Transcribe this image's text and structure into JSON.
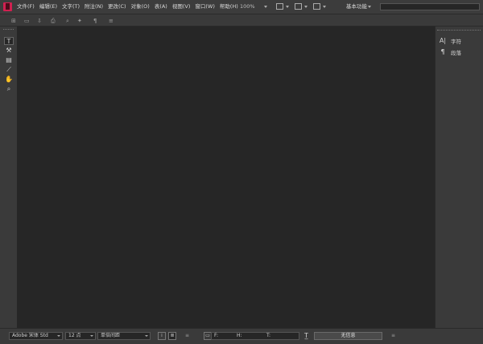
{
  "menu": [
    "文件(F)",
    "编辑(E)",
    "文字(T)",
    "附注(N)",
    "更改(C)",
    "对象(O)",
    "表(A)",
    "视图(V)",
    "窗口(W)",
    "帮助(H)"
  ],
  "zoom": "100%",
  "workspace": "基本功能",
  "tools": [
    {
      "icon": "type-tool-icon",
      "glyph": "T"
    },
    {
      "icon": "type-on-path-icon",
      "glyph": "⚒"
    },
    {
      "icon": "note-tool-icon",
      "glyph": "▤"
    },
    {
      "icon": "eyedropper-icon",
      "glyph": "⟋"
    },
    {
      "icon": "hand-tool-icon",
      "glyph": "✋"
    },
    {
      "icon": "zoom-tool-icon",
      "glyph": "⌕"
    }
  ],
  "panels": [
    {
      "icon": "character-icon",
      "glyph": "A|",
      "label": "字符"
    },
    {
      "icon": "paragraph-icon",
      "glyph": "¶",
      "label": "段落"
    }
  ],
  "status": {
    "font": "Adobe 宋体 Std",
    "size": "12 点",
    "leading": "单倍间距",
    "f_label": "F:",
    "h_label": "H:",
    "t_label": "T:",
    "info": "无信息"
  },
  "colors": {
    "accent": "#d02050",
    "canvas": "#262626",
    "chrome": "#3a3a3a"
  }
}
